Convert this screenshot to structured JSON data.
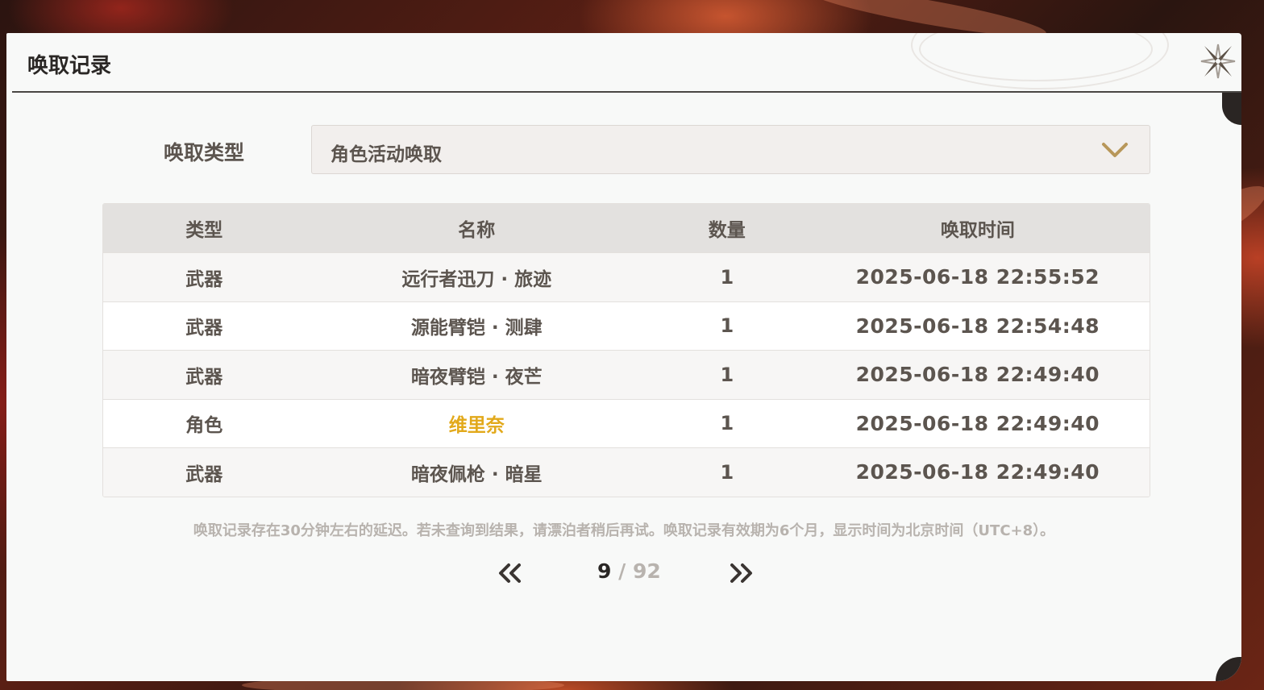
{
  "dialog": {
    "title": "唤取记录"
  },
  "filter": {
    "label": "唤取类型",
    "selected": "角色活动唤取"
  },
  "table": {
    "headers": [
      "类型",
      "名称",
      "数量",
      "唤取时间"
    ],
    "rows": [
      {
        "type": "武器",
        "name": "远行者迅刀 · 旅迹",
        "qty": "1",
        "time": "2025-06-18 22:55:52"
      },
      {
        "type": "武器",
        "name": "源能臂铠 · 测肆",
        "qty": "1",
        "time": "2025-06-18 22:54:48"
      },
      {
        "type": "武器",
        "name": "暗夜臂铠 · 夜芒",
        "qty": "1",
        "time": "2025-06-18 22:49:40"
      },
      {
        "type": "角色",
        "name": "维里奈",
        "qty": "1",
        "time": "2025-06-18 22:49:40",
        "highlight": "#e2a91b"
      },
      {
        "type": "武器",
        "name": "暗夜佩枪 · 暗星",
        "qty": "1",
        "time": "2025-06-18 22:49:40"
      }
    ]
  },
  "note": "唤取记录存在30分钟左右的延迟。若未查询到结果，请漂泊者稍后再试。唤取记录有效期为6个月，显示时间为北京时间（UTC+8）。",
  "pagination": {
    "current": "9",
    "separator": " / ",
    "total": "92",
    "prev_icon": "double-chevron-left-icon",
    "next_icon": "double-chevron-right-icon"
  },
  "colors": {
    "accent_gold": "#b8975a",
    "highlight_gold": "#e2a91b",
    "text": "#5c554f"
  }
}
